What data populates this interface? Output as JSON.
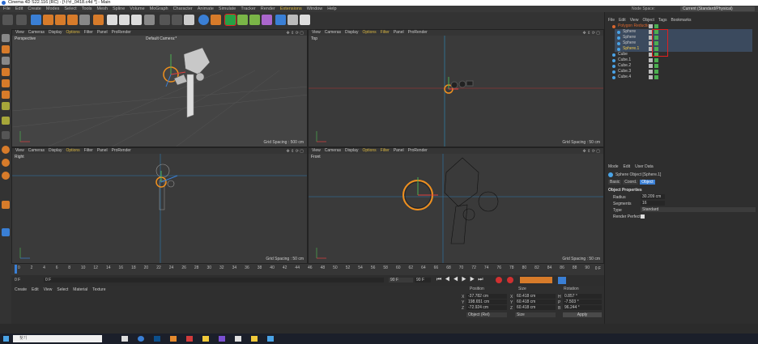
{
  "window": {
    "title": "Cinema 4D S22.116 (RC) - [나무_0418.c4d *] - Main"
  },
  "menubar": [
    "File",
    "Edit",
    "Create",
    "Modes",
    "Select",
    "Tools",
    "Mesh",
    "Spline",
    "Volume",
    "MoGraph",
    "Character",
    "Animate",
    "Simulate",
    "Tracker",
    "Render",
    "Extensions",
    "Window",
    "Help"
  ],
  "layout": {
    "label": "Node Space:",
    "value": "Current (Standard/Physical)"
  },
  "viewports": [
    {
      "name": "Perspective",
      "camera": "Default Camera:*",
      "grid": "Grid Spacing : 500 cm"
    },
    {
      "name": "Top",
      "grid": "Grid Spacing : 50 cm"
    },
    {
      "name": "Right",
      "grid": "Grid Spacing : 50 cm"
    },
    {
      "name": "Front",
      "grid": "Grid Spacing : 50 cm"
    }
  ],
  "viewport_menu": [
    "View",
    "Cameras",
    "Display",
    "Options",
    "Filter",
    "Panel",
    "ProRender"
  ],
  "timeline": {
    "ticks": [
      "0",
      "2",
      "4",
      "6",
      "8",
      "10",
      "12",
      "14",
      "16",
      "18",
      "20",
      "22",
      "24",
      "26",
      "28",
      "30",
      "32",
      "34",
      "36",
      "38",
      "40",
      "42",
      "44",
      "46",
      "48",
      "50",
      "52",
      "54",
      "56",
      "58",
      "60",
      "62",
      "64",
      "66",
      "68",
      "70",
      "72",
      "74",
      "76",
      "78",
      "80",
      "82",
      "84",
      "86",
      "88",
      "90"
    ],
    "end_label": "0 F"
  },
  "playback": {
    "current": "0 F",
    "start": "0 F",
    "end1": "90 F",
    "end2": "90 F"
  },
  "material_menu": [
    "Create",
    "Edit",
    "View",
    "Select",
    "Material",
    "Texture"
  ],
  "coords": {
    "headers": [
      "Position",
      "Size",
      "Rotation"
    ],
    "rows": [
      {
        "axis": "X",
        "pos": "-37.782 cm",
        "saxis": "X",
        "size": "60.418 cm",
        "raxis": "H",
        "rot": "0.857 °"
      },
      {
        "axis": "Y",
        "pos": "198.651 cm",
        "saxis": "Y",
        "size": "60.418 cm",
        "raxis": "P",
        "rot": "-7.503 °"
      },
      {
        "axis": "Z",
        "pos": "-72.924 cm",
        "saxis": "Z",
        "size": "60.418 cm",
        "raxis": "B",
        "rot": "96.244 °"
      }
    ],
    "mode1": "Object (Rel)",
    "mode2": "Size",
    "apply": "Apply"
  },
  "object_manager": {
    "menu": [
      "File",
      "Edit",
      "View",
      "Object",
      "Tags",
      "Bookmarks"
    ],
    "objects": [
      {
        "name": "Polygon Reduction",
        "sel": "parent"
      },
      {
        "name": "Sphere",
        "sel": "child"
      },
      {
        "name": "Sphere",
        "sel": "child"
      },
      {
        "name": "Sphere",
        "sel": "child"
      },
      {
        "name": "Sphere.1",
        "sel": "active"
      },
      {
        "name": "Cube",
        "sel": "none"
      },
      {
        "name": "Cube.1",
        "sel": "none"
      },
      {
        "name": "Cube.2",
        "sel": "none"
      },
      {
        "name": "Cube.3",
        "sel": "none"
      },
      {
        "name": "Cube.4",
        "sel": "none"
      }
    ]
  },
  "attributes": {
    "menu": [
      "Mode",
      "Edit",
      "User Data"
    ],
    "object_title": "Sphere Object [Sphere.1]",
    "tabs": [
      "Basic",
      "Coord.",
      "Object"
    ],
    "section": "Object Properties",
    "fields": [
      {
        "label": "Radius",
        "value": "30.209 cm"
      },
      {
        "label": "Segments",
        "value": "16"
      },
      {
        "label": "Type",
        "value": "Standard"
      },
      {
        "label": "Render Perfect",
        "value": ""
      }
    ]
  },
  "taskbar": {
    "search_placeholder": "찾기"
  }
}
